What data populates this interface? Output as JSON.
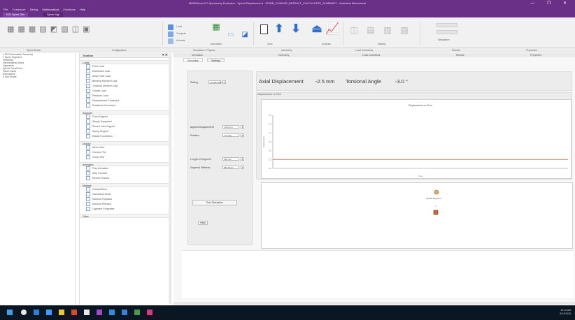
{
  "window": {
    "title": "MMDWorks 2.0 Spirometry Evaluator - Spinal Displacement - SPINE_CHANGE_DEFAULT_CALCULATED_SUMMARY - Autodesk Mechanical",
    "controls": "—  ❐  ✕"
  },
  "menubar": [
    "File",
    "Customize",
    "Debug",
    "Mathematical",
    "Functions",
    "Help"
  ],
  "ribbon_tabs": {
    "tab1": "ISO Spine Sim",
    "tab2": "Spine Mgr"
  },
  "ribbon": {
    "toolbar_glyphs": "▦ ▦ ▦ ▤ ◩ ▧ ◫ ▣",
    "group_labels": [
      "Calculation",
      "View",
      "Analysis",
      "Display",
      "Navigation"
    ],
    "small_btns": [
      "Load",
      "Compute",
      "Animate"
    ]
  },
  "panel_heads": [
    "Spinal Model",
    "Configuration",
    "Simulation / Physics",
    "Geometry",
    "Load Conditions",
    "Results",
    "Properties"
  ],
  "tree": {
    "items": [
      "▸ 2D Deformation Summary",
      "  ▾ Spine Segment",
      "     Vertebrae",
      "     Intervertebral Discs",
      "     Ligaments",
      "     Spinal Canal/Cord",
      "     Facet Joints",
      "     Boundaries",
      "  ▸ Sub Model"
    ]
  },
  "palette": {
    "header": "Toolbox",
    "sections": [
      {
        "title": "Loads",
        "items": [
          "Point Load",
          "Distributed Load",
          "Axial Force Load",
          "Bending Moment Load",
          "Torsional Moment Load",
          "Gravity Load",
          "Pressure Load",
          "Displacement Constraint",
          "Rotational Constraint"
        ]
      },
      {
        "title": "Supports",
        "items": [
          "Fixed Support",
          "Simply Supported",
          "Pinned Joint Support",
          "Spring Support",
          "Elastic Foundation"
        ]
      },
      {
        "title": "Display",
        "items": [
          "Mesh View",
          "Contour Plot",
          "Vector Plot"
        ]
      },
      {
        "title": "Animation",
        "items": [
          "Play Animation",
          "Step Forward",
          "Record Frames"
        ]
      },
      {
        "title": "Material",
        "items": [
          "Cortical Bone",
          "Cancellous Bone",
          "Nucleus Pulposus",
          "Annulus Fibrosus",
          "Ligament Properties"
        ]
      },
      {
        "title": "Other",
        "items": []
      }
    ]
  },
  "main": {
    "tabs": [
      "Simulation",
      "Geometry",
      "Load Conditions",
      "Results",
      "Properties"
    ],
    "subtabs": [
      "Simulation",
      "Settings"
    ],
    "controls": {
      "setting_label": "Setting",
      "setting_value": "Lumbar Spine",
      "field1_label": "Applied Displacement",
      "field1_value": "-25.0 mm",
      "field2_label": "Rotation",
      "field2_value": "-3.0 deg",
      "field3_label": "Length of Segment",
      "field3_value": "120 mm",
      "field4_label": "Segment Stiffness",
      "field4_value": "350 N/mm",
      "calc_button": "Run Simulation",
      "help_button": "Help"
    },
    "readout": {
      "disp_label": "Axial Displacement",
      "disp_value": "-2.5 mm",
      "angle_label": "Torsional Angle",
      "angle_value": "-3.0 °"
    },
    "chart_panel_label": "Displacement vs Time",
    "diagram": {
      "node_label": "Spinal Segment"
    }
  },
  "chart_data": {
    "type": "line",
    "title": "Displacement vs Time",
    "xlabel": "Time",
    "ylabel": "Displacement",
    "ylim": [
      -3,
      0
    ],
    "y_ticks": [
      "0.0",
      "-0.5",
      "-1.0",
      "-1.5",
      "-2.0",
      "-2.5",
      "-3.0"
    ],
    "series": [
      {
        "name": "Axial",
        "values": [
          -2.5,
          -2.5,
          -2.5,
          -2.5,
          -2.5,
          -2.5,
          -2.5,
          -2.5,
          -2.5,
          -2.5
        ],
        "color": "#e0793b"
      }
    ],
    "grid": false
  },
  "taskbar": {
    "time": "10:24 AM",
    "date": "5/14/2025"
  },
  "colors": {
    "brand": "#6a2f86",
    "accent": "#2e6fd6",
    "series": "#e0793b"
  }
}
